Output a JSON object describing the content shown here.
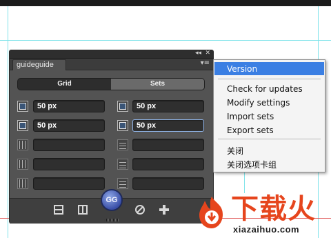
{
  "panel": {
    "tab_title": "guideguide",
    "collapse_glyph": "◂◂",
    "close_glyph": "✕",
    "menu_glyph": "▾≡",
    "mode_tabs": [
      {
        "label": "Grid",
        "active": false
      },
      {
        "label": "Sets",
        "active": true
      }
    ],
    "fields": {
      "left_margin": {
        "value": "50 px",
        "icon": "left-margin-icon"
      },
      "right_margin": {
        "value": "50 px",
        "icon": "right-margin-icon"
      },
      "top_margin": {
        "value": "50 px",
        "icon": "top-margin-icon"
      },
      "bottom_margin": {
        "value": "50 px",
        "icon": "bottom-margin-icon"
      },
      "columns": {
        "value": "",
        "icon": "columns-icon"
      },
      "rows": {
        "value": "",
        "icon": "rows-icon"
      },
      "column_gutter": {
        "value": "",
        "icon": "column-gutter-icon"
      },
      "row_gutter": {
        "value": "",
        "icon": "row-gutter-icon"
      },
      "column_midpoint": {
        "value": "",
        "icon": "column-midpoint-icon"
      },
      "row_midpoint": {
        "value": "",
        "icon": "row-midpoint-icon"
      }
    },
    "bottom_buttons": {
      "horizontal_midpoint": "horizontal-midpoint-icon",
      "vertical_midpoint": "vertical-midpoint-icon",
      "make_grid_label": "GG",
      "clear_guides": "clear-icon",
      "add_set": "plus-icon"
    }
  },
  "menu": {
    "items": [
      {
        "label": "Version",
        "highlighted": true
      },
      {
        "label": "Check for updates",
        "highlighted": false
      },
      {
        "label": "Modify settings",
        "highlighted": false
      },
      {
        "label": "Import sets",
        "highlighted": false
      },
      {
        "label": "Export sets",
        "highlighted": false
      },
      {
        "label": "关闭",
        "highlighted": false
      },
      {
        "label": "关闭选项卡组",
        "highlighted": false
      }
    ]
  },
  "watermark": {
    "brand": "下载火",
    "url": "xiazaihuo.com",
    "accent": "#e6451d"
  },
  "colors": {
    "guide": "#7fe3ea",
    "panel_bg": "#535353",
    "menu_highlight": "#3b7fe3",
    "gg_button": "#3a4fa8"
  }
}
